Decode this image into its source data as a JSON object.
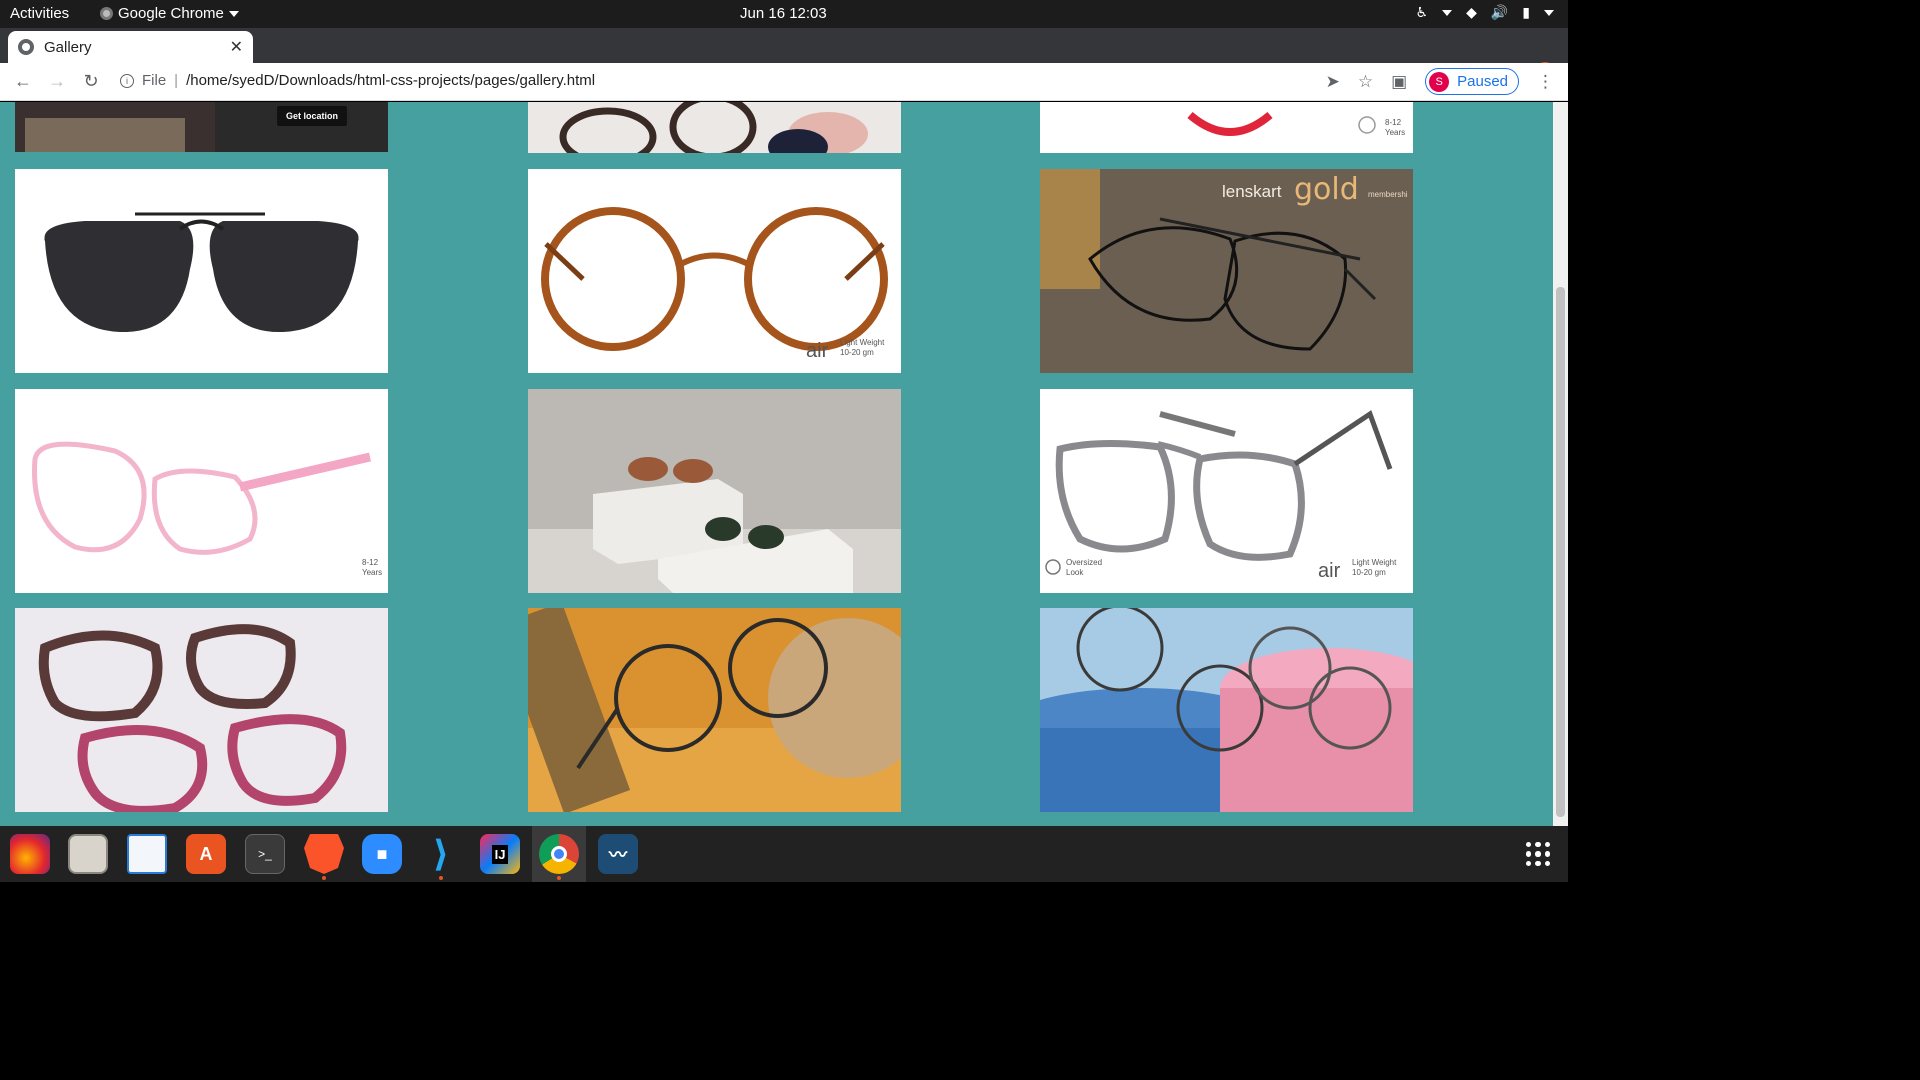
{
  "topbar": {
    "activities": "Activities",
    "app_name": "Google Chrome",
    "clock": "Jun 16  12:03",
    "tray_icons": [
      "accessibility-icon",
      "wifi-icon",
      "volume-icon",
      "battery-icon"
    ]
  },
  "browser": {
    "tab_title": "Gallery",
    "address_scheme_label": "File",
    "address": "/home/syedD/Downloads/html-css-projects/pages/gallery.html",
    "profile_initial": "S",
    "profile_status": "Paused"
  },
  "gallery": {
    "background_color": "#46a0a0",
    "cards": [
      {
        "alt": "store-banner",
        "overlay_text": "Get location"
      },
      {
        "alt": "assorted-glasses"
      },
      {
        "alt": "kids-red-frame",
        "badge_num": "8-12",
        "badge_word": "Years"
      },
      {
        "alt": "black-aviator-sunglasses"
      },
      {
        "alt": "tortoise-round-frame",
        "brand": "air",
        "weight_line1": "Light Weight",
        "weight_line2": "10-20 gm"
      },
      {
        "alt": "lenskart-gold-frame",
        "brand_a": "lenskart",
        "brand_b": "gold",
        "brand_c": "membershi"
      },
      {
        "alt": "pink-kids-frame",
        "badge_num": "8-12",
        "badge_word": "Years"
      },
      {
        "alt": "sunglasses-on-boxes"
      },
      {
        "alt": "grey-transparent-square-frame",
        "tag_line1": "Oversized",
        "tag_line2": "Look",
        "brand": "air",
        "weight_line1": "Light Weight",
        "weight_line2": "10-20 gm"
      },
      {
        "alt": "floral-cat-eye-frames"
      },
      {
        "alt": "round-metal-frame-on-wood"
      },
      {
        "alt": "metal-frames-on-pedestals"
      }
    ]
  },
  "dock": {
    "apps": [
      "firefox-icon",
      "files-icon",
      "writer-icon",
      "software-icon",
      "terminal-icon",
      "brave-icon",
      "zoom-icon",
      "vscode-icon",
      "intellij-icon",
      "chrome-icon",
      "mysql-workbench-icon"
    ],
    "terminal_glyph": ">_",
    "intellij_glyph": "IJ"
  }
}
